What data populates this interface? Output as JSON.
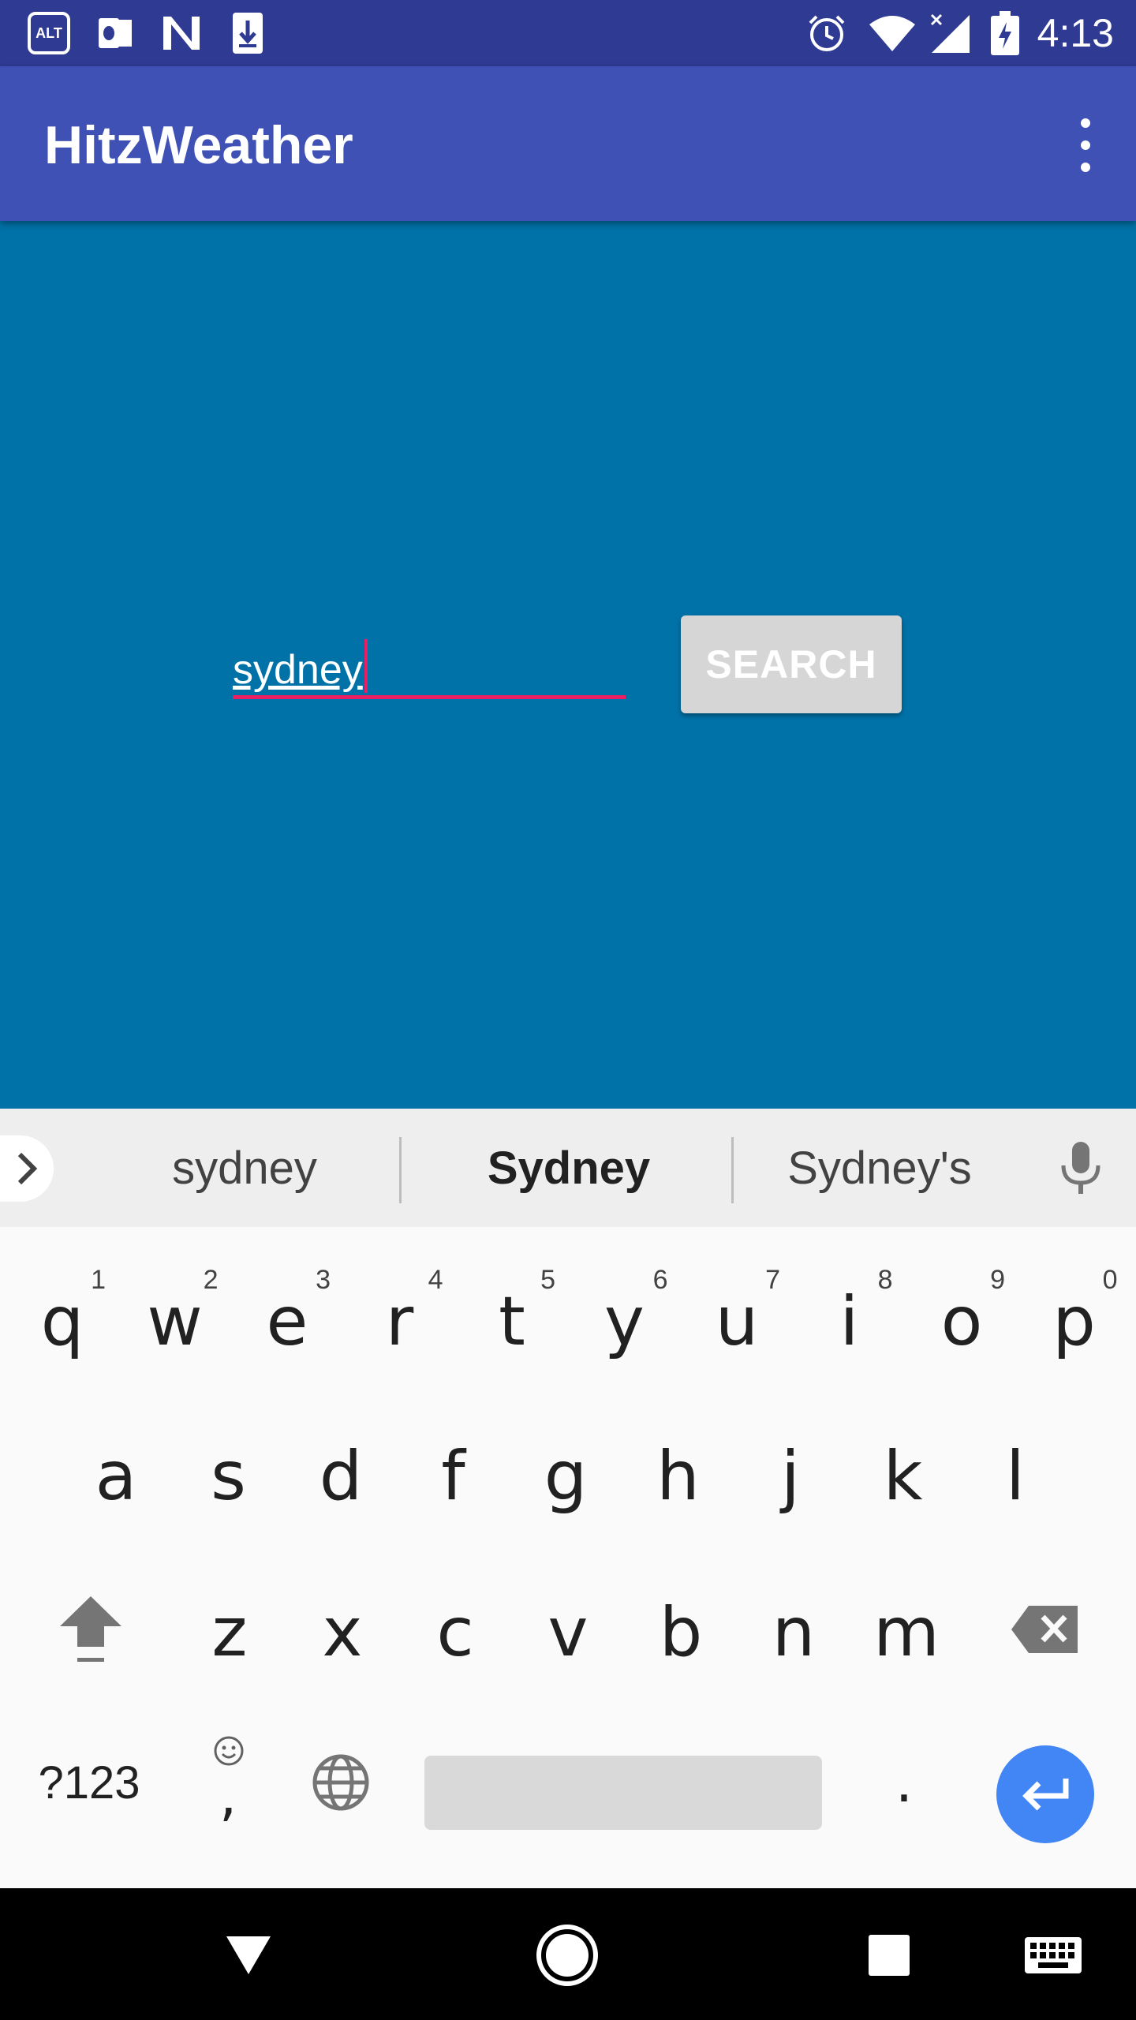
{
  "status_bar": {
    "time": "4:13",
    "left_icons": [
      "alt-balaji-icon",
      "outlook-icon",
      "n-icon",
      "download-icon"
    ],
    "right_icons": [
      "alarm-icon",
      "wifi-icon",
      "signal-icon",
      "battery-charging-icon"
    ]
  },
  "app_bar": {
    "title": "HitzWeather",
    "overflow_icon": "more-vert-icon"
  },
  "search": {
    "input_value": "sydney",
    "button_label": "SEARCH"
  },
  "suggestions": [
    "sydney",
    "Sydney",
    "Sydney's"
  ],
  "keyboard": {
    "row1": [
      {
        "k": "q",
        "h": "1"
      },
      {
        "k": "w",
        "h": "2"
      },
      {
        "k": "e",
        "h": "3"
      },
      {
        "k": "r",
        "h": "4"
      },
      {
        "k": "t",
        "h": "5"
      },
      {
        "k": "y",
        "h": "6"
      },
      {
        "k": "u",
        "h": "7"
      },
      {
        "k": "i",
        "h": "8"
      },
      {
        "k": "o",
        "h": "9"
      },
      {
        "k": "p",
        "h": "0"
      }
    ],
    "row2": [
      "a",
      "s",
      "d",
      "f",
      "g",
      "h",
      "j",
      "k",
      "l"
    ],
    "row3": [
      "z",
      "x",
      "c",
      "v",
      "b",
      "n",
      "m"
    ],
    "symbols_label": "?123",
    "comma_label": ",",
    "period_label": "."
  },
  "colors": {
    "status_bar": "#2f3a93",
    "app_bar": "#3f51b5",
    "content": "#0072a8",
    "accent": "#e91e63",
    "button": "#d6d6d6",
    "enter": "#4285f4"
  }
}
